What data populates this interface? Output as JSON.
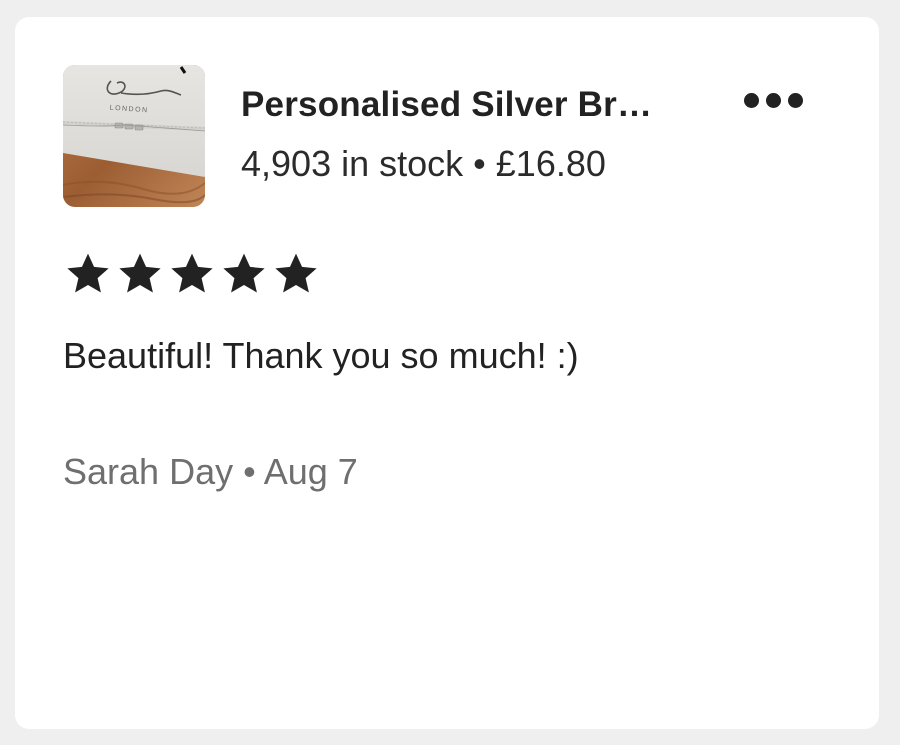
{
  "listing": {
    "title": "Personalised Silver Br…",
    "stock": "4,903 in stock",
    "separator": "•",
    "price": "£16.80",
    "thumbnail_logo_text": "LONDON"
  },
  "menu": {
    "icon": "more-horizontal-icon"
  },
  "review": {
    "rating": 5,
    "rating_max": 5,
    "text": "Beautiful! Thank you so much! :)",
    "author": "Sarah Day",
    "separator": "•",
    "date": "Aug 7"
  },
  "colors": {
    "page_background": "#efefef",
    "card_background": "#ffffff",
    "primary_text": "#222222",
    "secondary_text": "#6f6f6f",
    "star": "#222222"
  }
}
